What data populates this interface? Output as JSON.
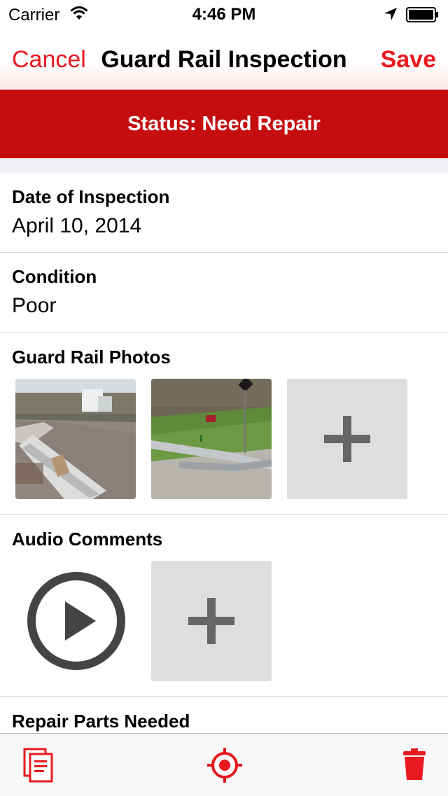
{
  "status_bar": {
    "carrier": "Carrier",
    "time": "4:46 PM",
    "wifi_icon": "wifi-icon",
    "location_icon": "location-arrow-icon",
    "battery_icon": "battery-icon"
  },
  "nav": {
    "cancel_label": "Cancel",
    "title": "Guard Rail Inspection",
    "save_label": "Save"
  },
  "status_banner": {
    "text": "Status: Need Repair",
    "color": "#c50d10"
  },
  "fields": {
    "date": {
      "label": "Date of Inspection",
      "value": "April 10, 2014"
    },
    "condition": {
      "label": "Condition",
      "value": "Poor"
    }
  },
  "photos": {
    "label": "Guard Rail Photos",
    "items": [
      "photo-1",
      "photo-2"
    ],
    "add_icon": "plus-icon"
  },
  "audio": {
    "label": "Audio Comments",
    "play_icon": "play-icon",
    "add_icon": "plus-icon"
  },
  "repair_parts": {
    "label": "Repair Parts Needed"
  },
  "toolbar": {
    "icons": [
      "copy-document-icon",
      "target-location-icon",
      "trash-icon"
    ],
    "accent": "#e8191f"
  }
}
